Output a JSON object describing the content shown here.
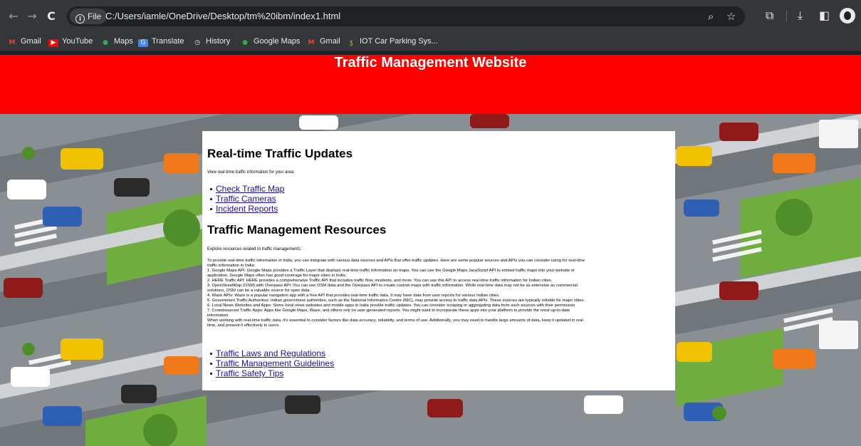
{
  "browser": {
    "nav": {
      "back": "←",
      "forward": "→",
      "reload": "C"
    },
    "file_chip": "File",
    "url": "C:/Users/iamle/OneDrive/Desktop/tm%20ibm/index1.html",
    "bookmarks": [
      {
        "label": "Gmail",
        "icon": "gmail-icon",
        "color": "#ea4335"
      },
      {
        "label": "YouTube",
        "icon": "youtube-icon",
        "color": "#ff0000"
      },
      {
        "label": "Maps",
        "icon": "maps-pin-icon",
        "color": "#34a853"
      },
      {
        "label": "Translate",
        "icon": "translate-icon",
        "color": "#4285f4"
      },
      {
        "label": "History",
        "icon": "history-icon",
        "color": "#e8eaed"
      },
      {
        "label": "Google Maps",
        "icon": "maps-pin-icon",
        "color": "#34a853"
      },
      {
        "label": "Gmail",
        "icon": "gmail-icon",
        "color": "#ea4335"
      },
      {
        "label": "IOT Car Parking Sys...",
        "icon": "iot-icon",
        "color": "#fbbc04"
      }
    ]
  },
  "page": {
    "title": "Traffic Management Website",
    "header_color": "#ff0000",
    "updates": {
      "heading": "Real-time Traffic Updates",
      "intro": "View real-time traffic information for your area:",
      "links": [
        "Check Traffic Map",
        "Traffic Cameras",
        "Incident Reports"
      ]
    },
    "resources": {
      "heading": "Traffic Management Resources",
      "intro": "Explore resources related to traffic managements :",
      "body_lines": [
        "To provide real-time traffic information in India, you can integrate with various data sources and APIs that offer traffic updates. Here are some popular sources and APIs you can consider using for real-time",
        "traffic information in India:",
        "1. Google Maps API: Google Maps provides a Traffic Layer that displays real-time traffic information on maps. You can use the Google Maps JavaScript API to embed traffic maps into your website or",
        "application. Google Maps often has good coverage for major cities in India.",
        "2. HERE Traffic API: HERE provides a comprehensive Traffic API that includes traffic flow, incidents, and more. You can use this API to access real-time traffic information for Indian cities.",
        "3. OpenStreetMap (OSM) with Overpass API: You can use OSM data and the Overpass API to create custom maps with traffic information. While real-time data may not be as extensive as commercial",
        "solutions, OSM can be a valuable source for open data.",
        "4. Waze APIs: Waze is a popular navigation app with a free API that provides real-time traffic data. It may have data from user reports for various Indian cities.",
        "5. Government Traffic Authorities: Indian government authorities, such as the National Informatics Centre (NIC), may provide access to traffic data APIs. These sources are typically reliable for major cities.",
        "6. Local News Websites and Apps: Some local news websites and mobile apps in India provide traffic updates. You can consider scraping or aggregating data from such sources with their permission.",
        "7. Crowdsourced Traffic Apps: Apps like Google Maps, Waze, and others rely on user-generated reports. You might want to incorporate these apps into your platform to provide the most up-to-date",
        "information.",
        "When working with real-time traffic data, it's essential to consider factors like data accuracy, reliability, and terms of use. Additionally, you may need to handle large amounts of data, keep it updated in real",
        "time, and present it effectively to users."
      ],
      "links": [
        "Traffic Laws and Regulations",
        "Traffic Management Guidelines",
        "Traffic Safety Tips"
      ]
    }
  }
}
